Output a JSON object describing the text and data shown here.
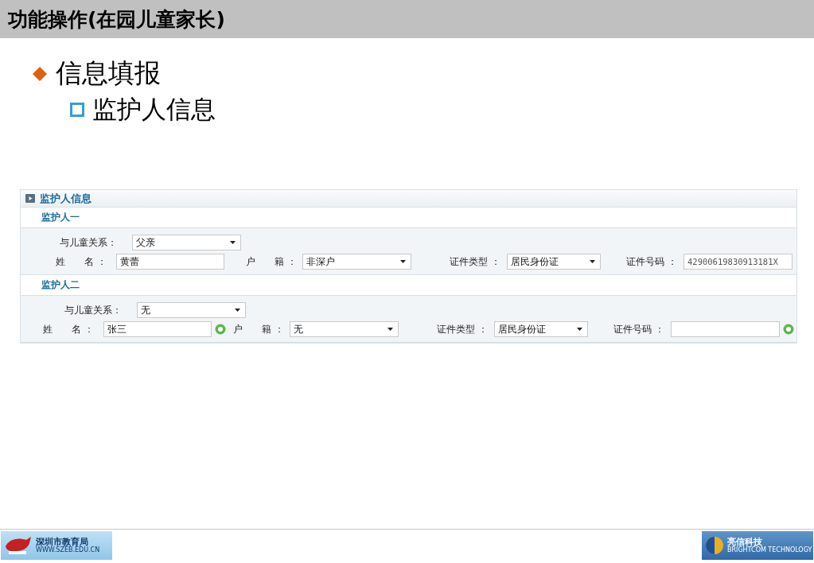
{
  "slide_title": "功能操作(在园儿童家长)",
  "bullets": [
    {
      "text": "信息填报",
      "children": [
        {
          "text": "监护人信息"
        }
      ]
    }
  ],
  "panel": {
    "title": "监护人信息",
    "guardians": [
      {
        "heading": "监护人一",
        "relation": {
          "label": "与儿童关系：",
          "value": "父亲"
        },
        "fields": [
          {
            "kind": "input",
            "label": "姓　　名 ：",
            "value": "黄蕾",
            "help": false
          },
          {
            "kind": "select",
            "label": "户　　籍 ：",
            "value": "非深户",
            "help": false
          },
          {
            "kind": "select",
            "label": "证件类型 ：",
            "value": "居民身份证",
            "help": false
          },
          {
            "kind": "input",
            "label": "证件号码 ：",
            "value": "42900619830913181X",
            "help": false
          }
        ]
      },
      {
        "heading": "监护人二",
        "relation": {
          "label": "与儿童关系：",
          "value": "无"
        },
        "fields": [
          {
            "kind": "input",
            "label": "姓　　名 ：",
            "value": "张三",
            "help": true
          },
          {
            "kind": "select",
            "label": "户　　籍 ：",
            "value": "无",
            "help": false
          },
          {
            "kind": "select",
            "label": "证件类型 ：",
            "value": "居民身份证",
            "help": false
          },
          {
            "kind": "input",
            "label": "证件号码 ：",
            "help": true
          }
        ]
      }
    ]
  },
  "footer": {
    "left_logo": {
      "name": "深圳市教育局",
      "url": "WWW.SZEB.EDU.CN"
    },
    "right_logo": {
      "name": "亮信科技",
      "subtitle": "BRIGHTCOM TECHNOLOGY"
    }
  }
}
